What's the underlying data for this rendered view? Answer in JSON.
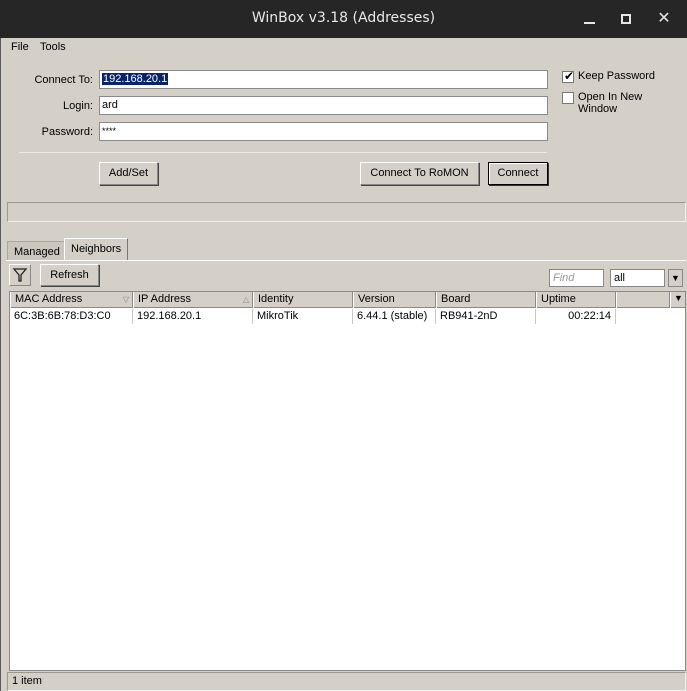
{
  "window": {
    "title": "WinBox v3.18 (Addresses)",
    "minimize_glyph": "",
    "close_glyph": "✕"
  },
  "menu": [
    "File",
    "Tools"
  ],
  "form": {
    "connect_to_label": "Connect To:",
    "connect_to_value": "192.168.20.1",
    "login_label": "Login:",
    "login_value": "ard",
    "password_label": "Password:",
    "password_value": "****",
    "keep_password_label": "Keep Password",
    "keep_password_checked": true,
    "open_new_window_label": "Open In New Window",
    "open_new_window_checked": false,
    "add_set_label": "Add/Set",
    "connect_romon_label": "Connect To RoMON",
    "connect_label": "Connect"
  },
  "tabs": [
    {
      "label": "Managed",
      "active": false
    },
    {
      "label": "Neighbors",
      "active": true
    }
  ],
  "toolbar": {
    "filter_icon": "filter-icon",
    "refresh_label": "Refresh",
    "find_placeholder": "Find",
    "scope_value": "all",
    "dropdown_glyph": "▼"
  },
  "table": {
    "columns": [
      "MAC Address",
      "IP Address",
      "Identity",
      "Version",
      "Board",
      "Uptime"
    ],
    "rows": [
      {
        "mac": "6C:3B:6B:78:D3:C0",
        "ip": "192.168.20.1",
        "identity": "MikroTik",
        "version": "6.44.1 (stable)",
        "board": "RB941-2nD",
        "uptime": "00:22:14"
      }
    ]
  },
  "status": {
    "item_count": "1 item"
  }
}
